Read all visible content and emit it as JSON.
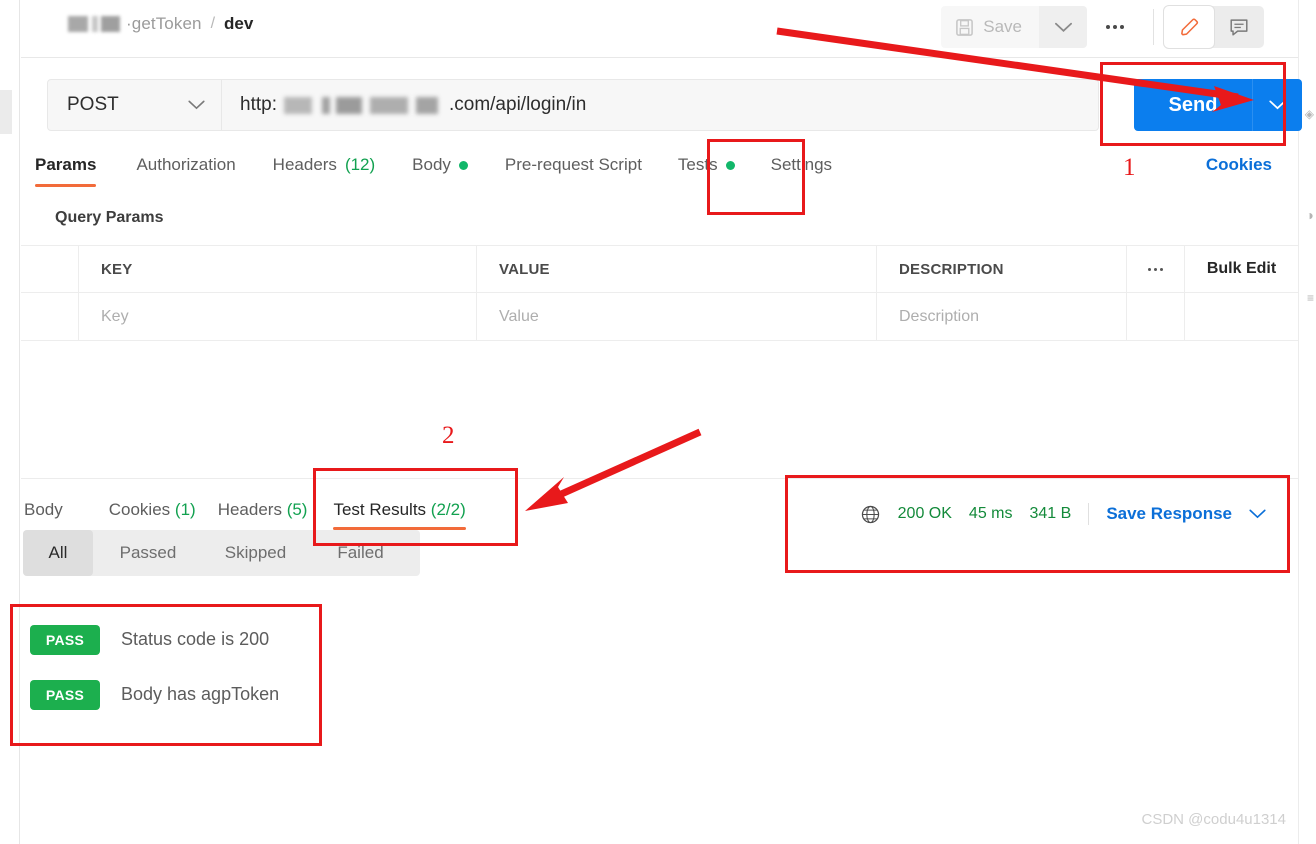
{
  "header": {
    "breadcrumb_collection": "·getToken",
    "breadcrumb_separator": "/",
    "breadcrumb_environment": "dev",
    "save_label": "Save",
    "save_caret_icon": "chevron-down-icon",
    "more_icon": "three-dots-icon",
    "edit_icon": "pencil-icon",
    "comment_icon": "comment-icon"
  },
  "request": {
    "method": "POST",
    "method_caret_icon": "chevron-down-icon",
    "url_prefix": "http:",
    "url_suffix": ".com/api/login/in",
    "send_label": "Send",
    "send_caret_icon": "chevron-down-icon"
  },
  "request_tabs": [
    {
      "label": "Params",
      "active": true,
      "dot": false,
      "count": ""
    },
    {
      "label": "Authorization",
      "active": false,
      "dot": false,
      "count": ""
    },
    {
      "label": "Headers",
      "active": false,
      "dot": false,
      "count": "(12)"
    },
    {
      "label": "Body",
      "active": false,
      "dot": true,
      "count": ""
    },
    {
      "label": "Pre-request Script",
      "active": false,
      "dot": false,
      "count": ""
    },
    {
      "label": "Tests",
      "active": false,
      "dot": true,
      "count": ""
    },
    {
      "label": "Settings",
      "active": false,
      "dot": false,
      "count": ""
    }
  ],
  "cookies_link": "Cookies",
  "query_params": {
    "title": "Query Params",
    "columns": [
      "KEY",
      "VALUE",
      "DESCRIPTION"
    ],
    "bulk_edit_label": "Bulk Edit",
    "more_icon": "three-dots-icon",
    "placeholder_row": {
      "key": "Key",
      "value": "Value",
      "description": "Description"
    }
  },
  "response_tabs": [
    {
      "label": "Body",
      "count": "",
      "active": false
    },
    {
      "label": "Cookies",
      "count": "(1)",
      "active": false
    },
    {
      "label": "Headers",
      "count": "(5)",
      "active": false
    },
    {
      "label": "Test Results",
      "count": "(2/2)",
      "active": true
    }
  ],
  "response_meta": {
    "globe_icon": "globe-icon",
    "status": "200 OK",
    "time": "45 ms",
    "size": "341 B",
    "save_response_label": "Save Response",
    "save_response_caret_icon": "chevron-down-icon"
  },
  "result_filters": [
    {
      "label": "All",
      "active": true
    },
    {
      "label": "Passed",
      "active": false
    },
    {
      "label": "Skipped",
      "active": false
    },
    {
      "label": "Failed",
      "active": false
    }
  ],
  "test_results": [
    {
      "status": "PASS",
      "name": "Status code is 200"
    },
    {
      "status": "PASS",
      "name": "Body has agpToken"
    }
  ],
  "annotations": {
    "marker_one": "1",
    "marker_two": "2",
    "accent_color": "#e8191b"
  },
  "watermark": "CSDN @codu4u1314"
}
